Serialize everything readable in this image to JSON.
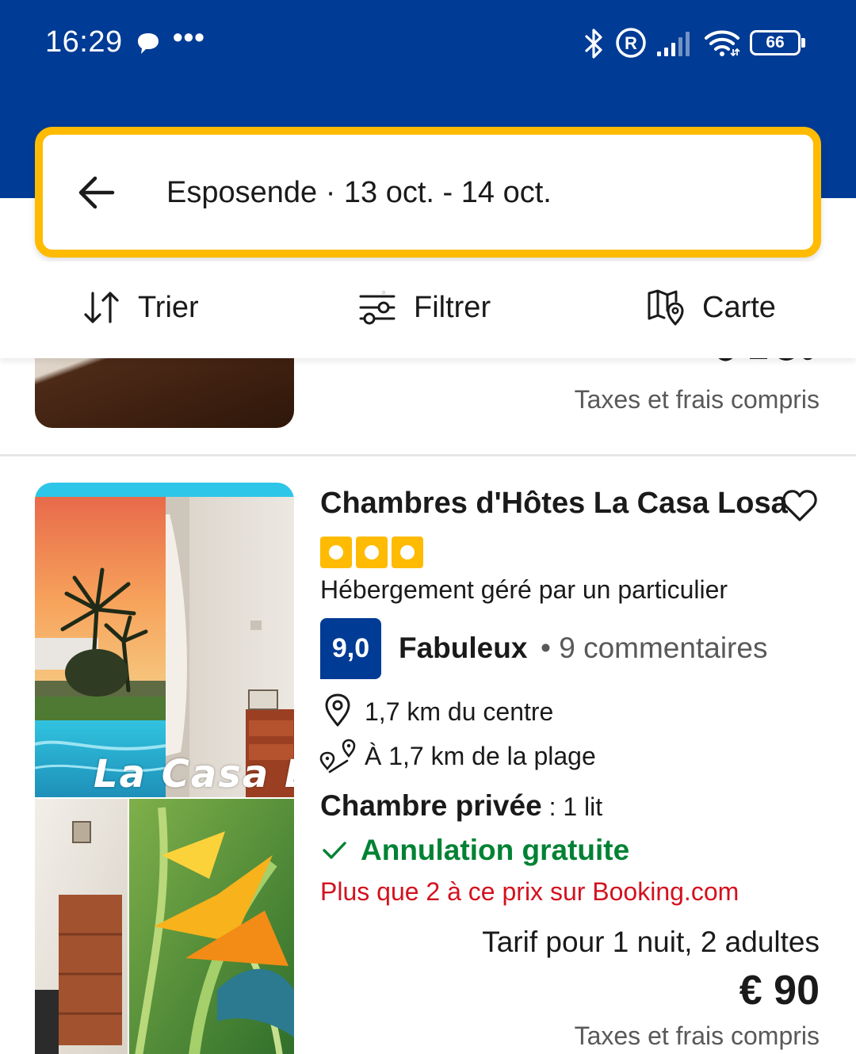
{
  "status_bar": {
    "time": "16:29",
    "more": "•••",
    "battery": "66"
  },
  "colors": {
    "brand": "#003b95",
    "accent": "#febb02",
    "success": "#008234",
    "alert": "#d4111e"
  },
  "search": {
    "summary": "Esposende · 13 oct. - 14 oct."
  },
  "toolbar": {
    "sort_label": "Trier",
    "filter_label": "Filtrer",
    "map_label": "Carte"
  },
  "previous_card": {
    "taxes_note": "Taxes et frais compris"
  },
  "listing": {
    "name": "Chambres d'Hôtes La Casa Losa",
    "photo_caption": "La Casa Lo",
    "star_count": 3,
    "host_type": "Hébergement géré par un particulier",
    "score": "9,0",
    "score_word": "Fabuleux",
    "reviews": "• 9 commentaires",
    "distance_center": "1,7 km du centre",
    "distance_beach": "À 1,7 km de la plage",
    "room_type": "Chambre privée",
    "room_sep": " : ",
    "room_beds": "1 lit",
    "cancellation": "Annulation gratuite",
    "scarcity": "Plus que 2 à ce prix sur Booking.com",
    "rate_desc": "Tarif pour 1 nuit, 2 adultes",
    "price": "€ 90",
    "taxes_note": "Taxes et frais compris"
  }
}
